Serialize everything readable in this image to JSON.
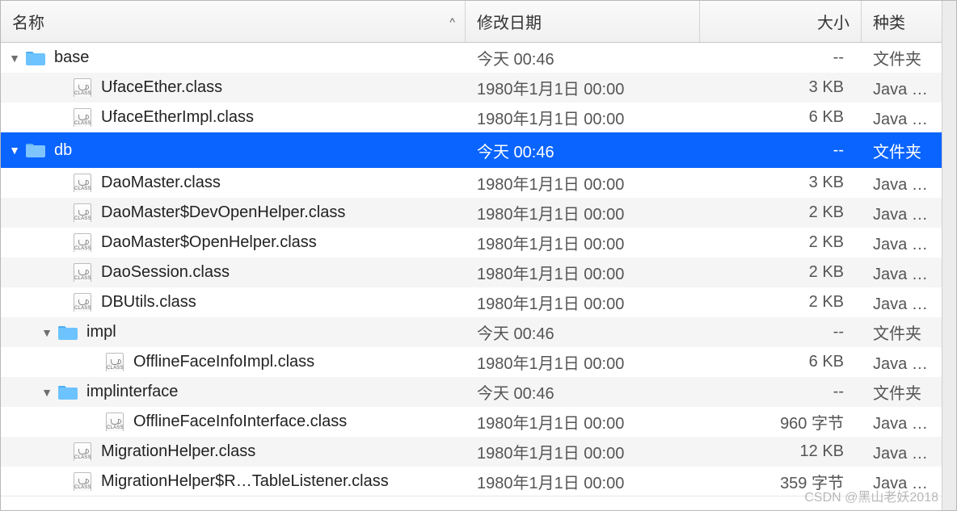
{
  "header": {
    "name": "名称",
    "date": "修改日期",
    "size": "大小",
    "kind": "种类",
    "sort_indicator": "^"
  },
  "rows": [
    {
      "indent": 0,
      "type": "folder",
      "expanded": true,
      "name": "base",
      "date": "今天 00:46",
      "size": "--",
      "kind": "文件夹",
      "selected": false
    },
    {
      "indent": 1,
      "type": "class",
      "name": "UfaceEther.class",
      "date": "1980年1月1日 00:00",
      "size": "3 KB",
      "kind": "Java 类文",
      "selected": false
    },
    {
      "indent": 1,
      "type": "class",
      "name": "UfaceEtherImpl.class",
      "date": "1980年1月1日 00:00",
      "size": "6 KB",
      "kind": "Java 类文",
      "selected": false
    },
    {
      "indent": 0,
      "type": "folder",
      "expanded": true,
      "name": "db",
      "date": "今天 00:46",
      "size": "--",
      "kind": "文件夹",
      "selected": true
    },
    {
      "indent": 1,
      "type": "class",
      "name": "DaoMaster.class",
      "date": "1980年1月1日 00:00",
      "size": "3 KB",
      "kind": "Java 类文",
      "selected": false
    },
    {
      "indent": 1,
      "type": "class",
      "name": "DaoMaster$DevOpenHelper.class",
      "date": "1980年1月1日 00:00",
      "size": "2 KB",
      "kind": "Java 类文",
      "selected": false
    },
    {
      "indent": 1,
      "type": "class",
      "name": "DaoMaster$OpenHelper.class",
      "date": "1980年1月1日 00:00",
      "size": "2 KB",
      "kind": "Java 类文",
      "selected": false
    },
    {
      "indent": 1,
      "type": "class",
      "name": "DaoSession.class",
      "date": "1980年1月1日 00:00",
      "size": "2 KB",
      "kind": "Java 类文",
      "selected": false
    },
    {
      "indent": 1,
      "type": "class",
      "name": "DBUtils.class",
      "date": "1980年1月1日 00:00",
      "size": "2 KB",
      "kind": "Java 类文",
      "selected": false
    },
    {
      "indent": 1,
      "type": "folder",
      "expanded": true,
      "name": "impl",
      "date": "今天 00:46",
      "size": "--",
      "kind": "文件夹",
      "selected": false
    },
    {
      "indent": 2,
      "type": "class",
      "name": "OfflineFaceInfoImpl.class",
      "date": "1980年1月1日 00:00",
      "size": "6 KB",
      "kind": "Java 类文",
      "selected": false
    },
    {
      "indent": 1,
      "type": "folder",
      "expanded": true,
      "name": "implinterface",
      "date": "今天 00:46",
      "size": "--",
      "kind": "文件夹",
      "selected": false
    },
    {
      "indent": 2,
      "type": "class",
      "name": "OfflineFaceInfoInterface.class",
      "date": "1980年1月1日 00:00",
      "size": "960 字节",
      "kind": "Java 类文",
      "selected": false
    },
    {
      "indent": 1,
      "type": "class",
      "name": "MigrationHelper.class",
      "date": "1980年1月1日 00:00",
      "size": "12 KB",
      "kind": "Java 类文",
      "selected": false
    },
    {
      "indent": 1,
      "type": "class",
      "name": "MigrationHelper$R…TableListener.class",
      "date": "1980年1月1日 00:00",
      "size": "359 字节",
      "kind": "Java 类文",
      "selected": false
    }
  ],
  "icons": {
    "class_tag": "CLASS"
  },
  "watermark": "CSDN @黑山老妖2018"
}
